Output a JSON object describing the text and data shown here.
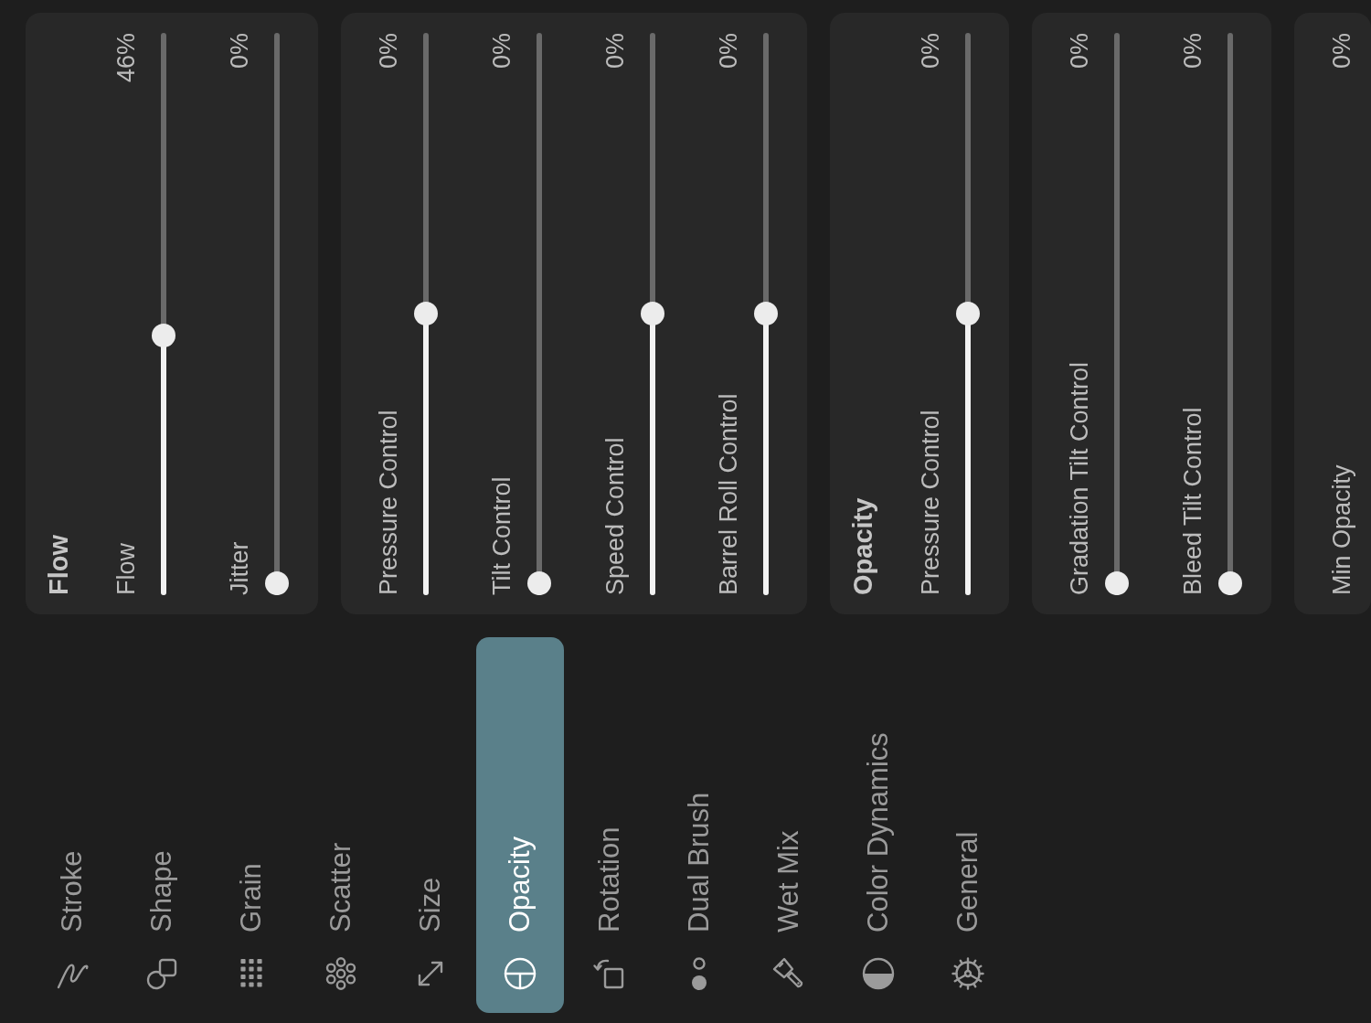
{
  "tabs": [
    {
      "label": "Stroke",
      "selected": false
    },
    {
      "label": "Shape",
      "selected": false
    },
    {
      "label": "Grain",
      "selected": false
    },
    {
      "label": "Scatter",
      "selected": false
    },
    {
      "label": "Size",
      "selected": false
    },
    {
      "label": "Opacity",
      "selected": true
    },
    {
      "label": "Rotation",
      "selected": false
    },
    {
      "label": "Dual Brush",
      "selected": false
    },
    {
      "label": "Wet Mix",
      "selected": false
    },
    {
      "label": "Color Dynamics",
      "selected": false
    },
    {
      "label": "General",
      "selected": false
    }
  ],
  "panels": [
    {
      "title": "Flow",
      "sliders": [
        {
          "label": "Flow",
          "value": "46%",
          "level": 0.46
        },
        {
          "label": "Jitter",
          "value": "0%",
          "level": 0
        }
      ]
    },
    {
      "sliders": [
        {
          "label": "Pressure Control",
          "value": "0%",
          "level": 0.5
        },
        {
          "label": "Tilt Control",
          "value": "0%",
          "level": 0
        },
        {
          "label": "Speed Control",
          "value": "0%",
          "level": 0.5
        },
        {
          "label": "Barrel Roll Control",
          "value": "0%",
          "level": 0.5
        }
      ]
    },
    {
      "title": "Opacity",
      "sliders": [
        {
          "label": "Pressure Control",
          "value": "0%",
          "level": 0.5
        }
      ]
    },
    {
      "sliders": [
        {
          "label": "Gradation Tilt Control",
          "value": "0%",
          "level": 0
        },
        {
          "label": "Bleed Tilt Control",
          "value": "0%",
          "level": 0
        }
      ]
    },
    {
      "sliders": [
        {
          "label": "Min Opacity",
          "value": "0%"
        }
      ]
    }
  ]
}
